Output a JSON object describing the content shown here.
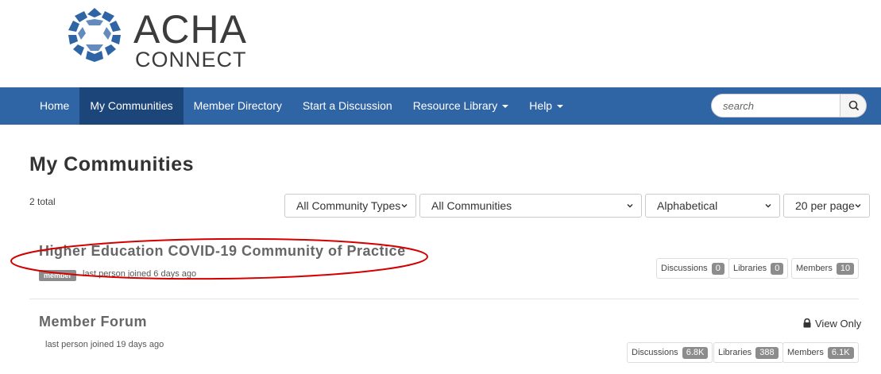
{
  "logo": {
    "line1": "ACHA",
    "line2": "CONNECT",
    "mark_color": "#2f64a5"
  },
  "nav": {
    "items": [
      {
        "label": "Home"
      },
      {
        "label": "My Communities",
        "active": true
      },
      {
        "label": "Member Directory"
      },
      {
        "label": "Start a Discussion"
      },
      {
        "label": "Resource Library",
        "dropdown": true
      },
      {
        "label": "Help",
        "dropdown": true
      }
    ],
    "search": {
      "placeholder": "search",
      "icon": "search-icon"
    },
    "colors": {
      "bar": "#2f64a5",
      "active": "#1c4679"
    }
  },
  "page": {
    "title": "My Communities",
    "total": "2 total"
  },
  "filters": {
    "type": "All Community Types",
    "scope": "All Communities",
    "sort": "Alphabetical",
    "per_page": "20 per page"
  },
  "communities": [
    {
      "title": "Higher Education COVID-19 Community of Practice",
      "badge": "member",
      "last_joined": "last person joined 6 days ago",
      "stats": {
        "discussions_label": "Discussions",
        "discussions": "0",
        "libraries_label": "Libraries",
        "libraries": "0",
        "members_label": "Members",
        "members": "10"
      }
    },
    {
      "title": "Member Forum",
      "last_joined": "last person joined 19 days ago",
      "access": "View Only",
      "stats": {
        "discussions_label": "Discussions",
        "discussions": "6.8K",
        "libraries_label": "Libraries",
        "libraries": "388",
        "members_label": "Members",
        "members": "6.1K"
      }
    }
  ],
  "annotation_color": "#d40000"
}
